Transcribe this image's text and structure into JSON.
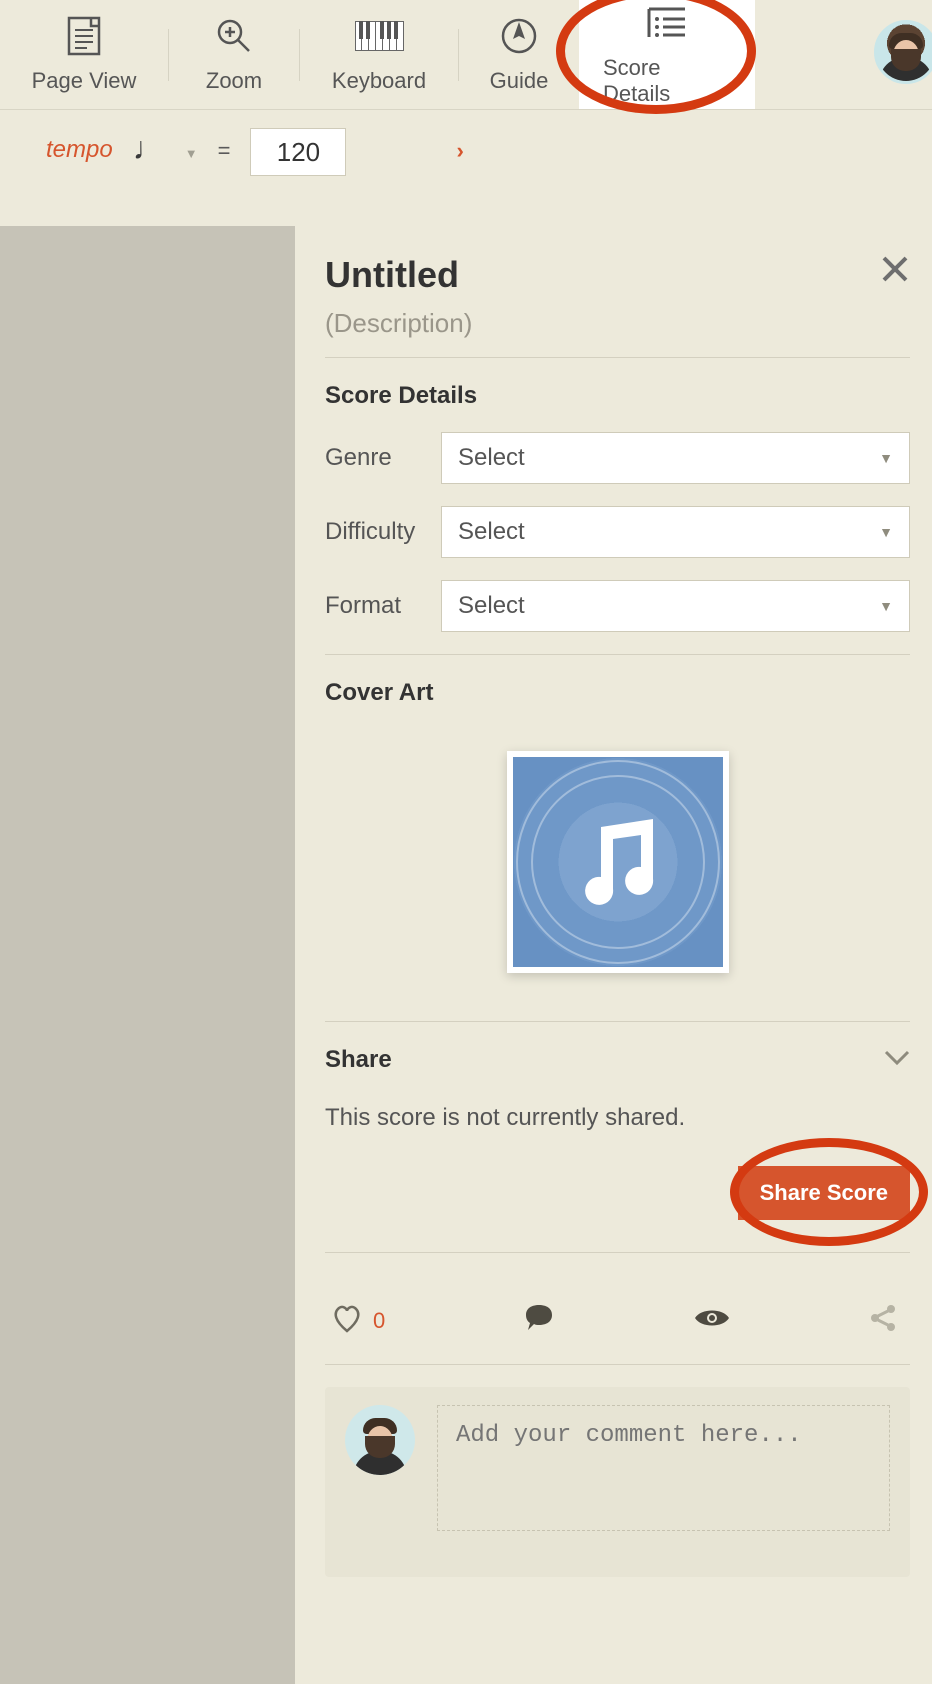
{
  "toolbar": {
    "items": [
      {
        "label": "Page View"
      },
      {
        "label": "Zoom"
      },
      {
        "label": "Keyboard"
      },
      {
        "label": "Guide"
      },
      {
        "label": "Score Details"
      }
    ]
  },
  "tempo": {
    "label": "tempo",
    "equals": "=",
    "value": "120"
  },
  "panel": {
    "title": "Untitled",
    "description": "(Description)",
    "score_details_heading": "Score Details",
    "fields": {
      "genre_label": "Genre",
      "genre_value": "Select",
      "difficulty_label": "Difficulty",
      "difficulty_value": "Select",
      "format_label": "Format",
      "format_value": "Select"
    },
    "cover_art_heading": "Cover Art",
    "share_heading": "Share",
    "share_status": "This score is not currently shared.",
    "share_button": "Share Score",
    "likes": "0",
    "comment_placeholder": "Add your comment here..."
  }
}
